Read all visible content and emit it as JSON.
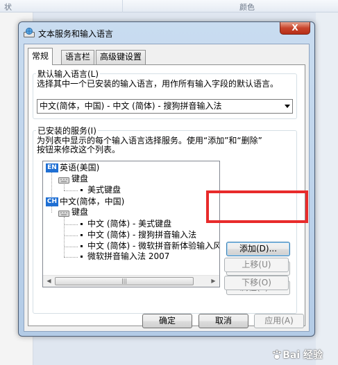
{
  "background": {
    "columns": [
      "状",
      "颜色"
    ]
  },
  "window": {
    "title": "文本服务和输入语言",
    "close_label": "X"
  },
  "tabs": [
    {
      "label": "常规",
      "active": true
    },
    {
      "label": "语言栏",
      "active": false
    },
    {
      "label": "高级键设置",
      "active": false
    }
  ],
  "default_language": {
    "group_label": "默认输入语言(L)",
    "description": "选择其中一个已安装的输入语言，用作所有输入字段的默认语言。",
    "selected_value": "中文(简体，中国) - 中文 (简体) - 搜狗拼音输入法"
  },
  "installed_services": {
    "group_label": "已安装的服务(I)",
    "description_line1": "为列表中显示的每个输入语言选择服务。使用“添加”和“删除”",
    "description_line2": "按钮来修改这个列表。",
    "tree": {
      "lang1": {
        "badge": "EN",
        "label": "英语(美国)"
      },
      "lang1_keyboard": "键盘",
      "lang1_items": [
        "美式键盘"
      ],
      "lang2": {
        "badge": "CH",
        "label": "中文(简体，中国)"
      },
      "lang2_keyboard": "键盘",
      "lang2_items": [
        "中文 (简体) - 美式键盘",
        "中文 (简体) - 搜狗拼音输入法",
        "中文 (简体) - 微软拼音新体验输入风",
        "微软拼音输入法 2007"
      ]
    },
    "buttons": {
      "add": "添加(D)...",
      "remove": "删除(R)",
      "properties": "属性(P)...",
      "move_up": "上移(U)",
      "move_down": "下移(O)"
    }
  },
  "footer": {
    "ok": "确定",
    "cancel": "取消",
    "apply": "应用(A)"
  },
  "watermark": "Bai 经验",
  "colors": {
    "highlight": "#e82b2b",
    "lang_badge": "#1f6fd3"
  }
}
